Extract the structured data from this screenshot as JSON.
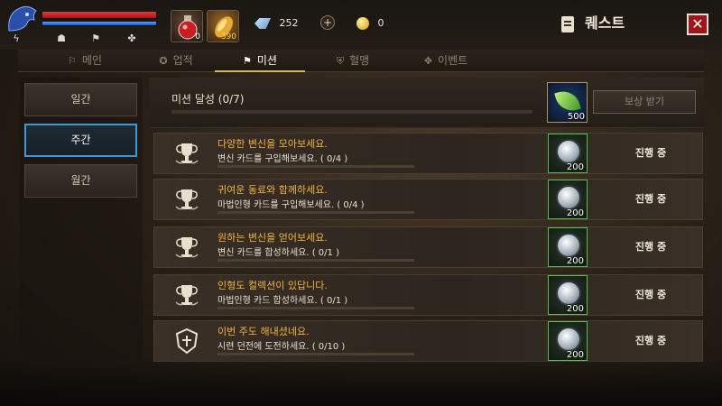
{
  "player": {
    "hp_fill": 1.0,
    "mp_fill": 1.0
  },
  "skills": [
    {
      "icon": "lightning-icon",
      "glyph": "ϟ"
    },
    {
      "icon": "helmet-icon",
      "glyph": "☗"
    },
    {
      "icon": "boot-icon",
      "glyph": "⚑"
    },
    {
      "icon": "buff-icon",
      "glyph": "✤"
    }
  ],
  "items": [
    {
      "icon": "potion-icon",
      "count": "0"
    },
    {
      "icon": "food-icon",
      "count": "390"
    }
  ],
  "currency": {
    "gems": "252",
    "plus": "+",
    "gold": "0"
  },
  "header": {
    "title": "퀘스트",
    "close_label": "✕"
  },
  "tabs": [
    {
      "label": "메인",
      "icon": "flag-icon",
      "glyph": "⚐"
    },
    {
      "label": "업적",
      "icon": "medal-icon",
      "glyph": "✪"
    },
    {
      "label": "미션",
      "icon": "flag-icon",
      "glyph": "⚑",
      "active": true
    },
    {
      "label": "혈맹",
      "icon": "shield-icon",
      "glyph": "⛨"
    },
    {
      "label": "이벤트",
      "icon": "gift-icon",
      "glyph": "✥"
    }
  ],
  "sidebar": {
    "items": [
      {
        "label": "일간"
      },
      {
        "label": "주간",
        "active": true
      },
      {
        "label": "월간"
      }
    ]
  },
  "achievement": {
    "label": "미션 달성 (0/7)",
    "progress": 0,
    "reward_count": "500",
    "claim_label": "보상 받기"
  },
  "quests": [
    {
      "title": "다양한 변신을 모아보세요.",
      "desc": "변신 카드를 구입해보세요. ( 0/4 )",
      "progress": 0,
      "reward": "200",
      "status": "진행 중"
    },
    {
      "title": "귀여운 동료와 함께하세요.",
      "desc": "마법인형 카드를 구입해보세요. ( 0/4 )",
      "progress": 0,
      "reward": "200",
      "status": "진행 중"
    },
    {
      "title": "원하는 변신을 얻어보세요.",
      "desc": "변신 카드를 합성하세요. ( 0/1 )",
      "progress": 0,
      "reward": "200",
      "status": "진행 중"
    },
    {
      "title": "인형도 컬렉션이 있답니다.",
      "desc": "마법인형 카드 합성하세요. ( 0/1 )",
      "progress": 0,
      "reward": "200",
      "status": "진행 중"
    },
    {
      "title": "이번 주도 해내셨네요.",
      "desc": "시련 던전에 도전하세요. ( 0/10 )",
      "progress": 0,
      "reward": "200",
      "status": "진행 중"
    }
  ]
}
